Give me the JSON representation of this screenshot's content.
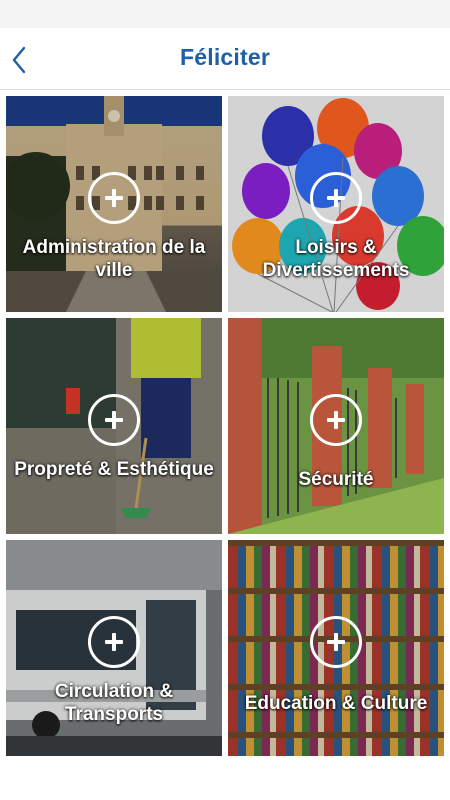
{
  "header": {
    "title": "Féliciter"
  },
  "tiles": [
    {
      "label": "Administration de la ville",
      "icon": "plus-circle-icon"
    },
    {
      "label": "Loisirs & Divertissements",
      "icon": "plus-circle-icon"
    },
    {
      "label": "Propreté & Esthétique",
      "icon": "plus-circle-icon"
    },
    {
      "label": "Sécurité",
      "icon": "plus-circle-icon"
    },
    {
      "label": "Circulation & Transports",
      "icon": "plus-circle-icon"
    },
    {
      "label": "Education & Culture",
      "icon": "plus-circle-icon"
    }
  ],
  "colors": {
    "title": "#1f5fa8",
    "back_arrow": "#1f5fa8",
    "icon_label": "#ffffff"
  }
}
